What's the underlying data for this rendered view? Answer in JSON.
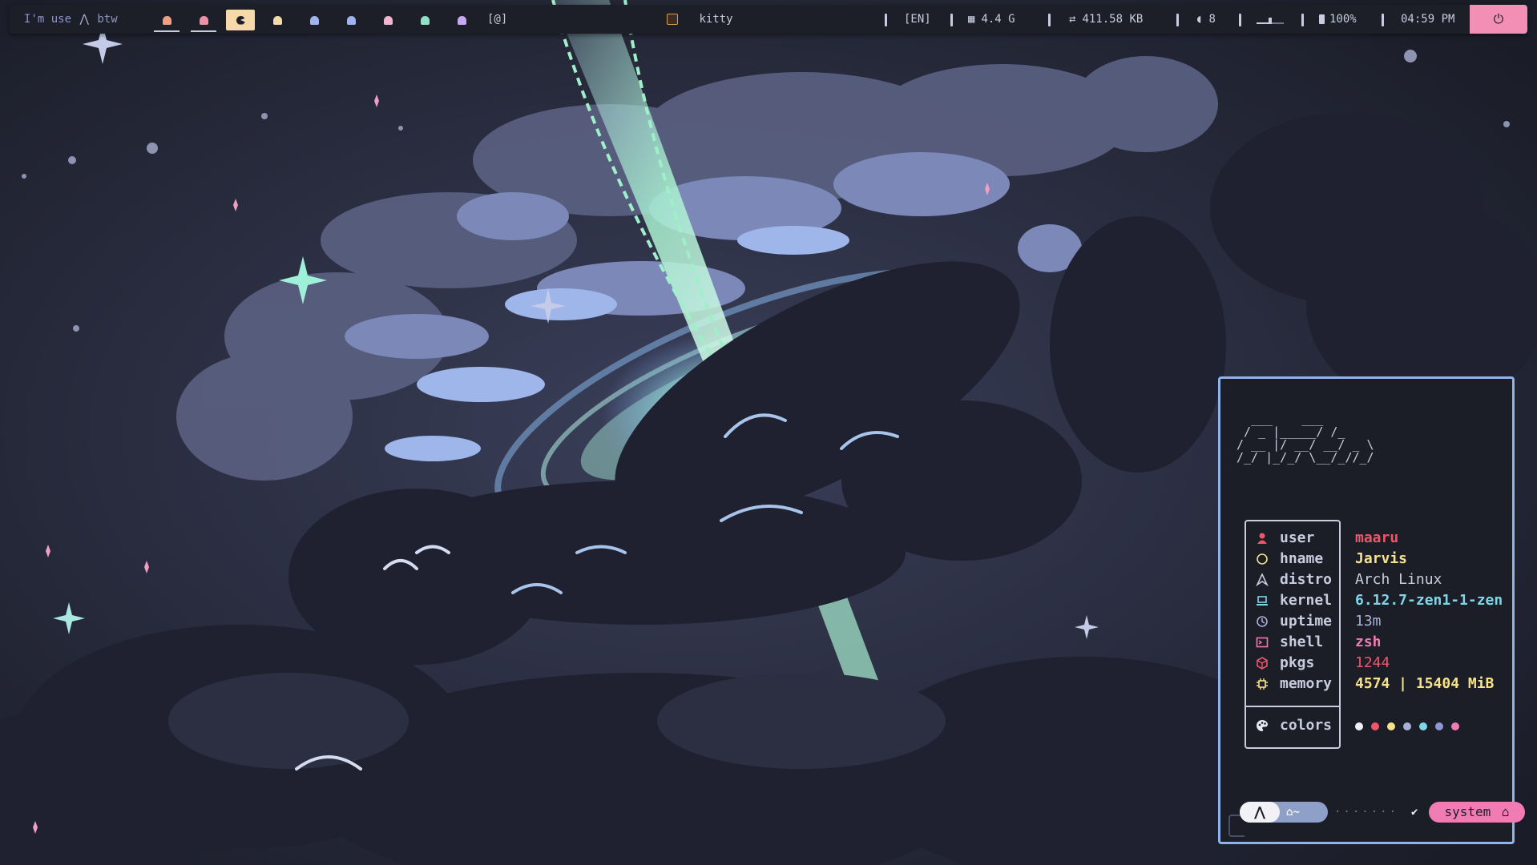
{
  "topbar": {
    "greeting_prefix": "I'm use",
    "greeting_suffix": "btw",
    "workspaces": [
      {
        "id": 1,
        "color": "#f0a07f",
        "state": "occupied"
      },
      {
        "id": 2,
        "color": "#f08fa8",
        "state": "occupied"
      },
      {
        "id": 3,
        "color": "#1c1e28",
        "state": "active"
      },
      {
        "id": 4,
        "color": "#f5d9a8",
        "state": "empty"
      },
      {
        "id": 5,
        "color": "#9db4f0",
        "state": "empty"
      },
      {
        "id": 6,
        "color": "#9db4f0",
        "state": "empty"
      },
      {
        "id": 7,
        "color": "#f3b4cf",
        "state": "empty"
      },
      {
        "id": 8,
        "color": "#8fe0c4",
        "state": "empty"
      },
      {
        "id": 9,
        "color": "#c8a8f5",
        "state": "empty"
      }
    ],
    "scratchpad_label": "[@]",
    "window_title": "kitty",
    "keyboard_layout": "[EN]",
    "memory_usage": "4.4 G",
    "network_rate": "411.58 KB",
    "cpu_label": "8",
    "battery": "100%",
    "clock": "04:59 PM",
    "volume_level": 0.5
  },
  "terminal": {
    "logo_lines": [
      "  ___    ___ ",
      " / _ |_____/ /_ ",
      "/ __ |/ __/ __/ _ \\",
      "/_/ |_/_/ \\__/_//_/"
    ],
    "info": [
      {
        "key": "user",
        "value": "maaru",
        "icon": "user-icon",
        "color": "#f0566b"
      },
      {
        "key": "hname",
        "value": "Jarvis",
        "icon": "hostname-icon",
        "color": "#f5e28a"
      },
      {
        "key": "distro",
        "value": "Arch Linux",
        "icon": "distro-icon",
        "color": "#c8ccde"
      },
      {
        "key": "kernel",
        "value": "6.12.7-zen1-1-zen",
        "icon": "laptop-icon",
        "color": "#7fd6e8"
      },
      {
        "key": "uptime",
        "value": "13m",
        "icon": "clock-icon",
        "color": "#a9b1d6"
      },
      {
        "key": "shell",
        "value": "zsh",
        "icon": "terminal-icon",
        "color": "#f07cb3"
      },
      {
        "key": "pkgs",
        "value": "1244",
        "icon": "package-icon",
        "color": "#f0566b"
      },
      {
        "key": "memory",
        "value": "4574 | 15404 MiB",
        "icon": "chip-icon",
        "color": "#f5e28a"
      }
    ],
    "colors_label": "colors",
    "color_swatches": [
      "#f2f2f6",
      "#f0566b",
      "#f5e28a",
      "#a9b1d6",
      "#7fd6e8",
      "#8f95d6",
      "#f07cb3"
    ],
    "prompt": {
      "home_label": "~",
      "dots": "·······",
      "check": "✔",
      "system_label": "system"
    }
  }
}
